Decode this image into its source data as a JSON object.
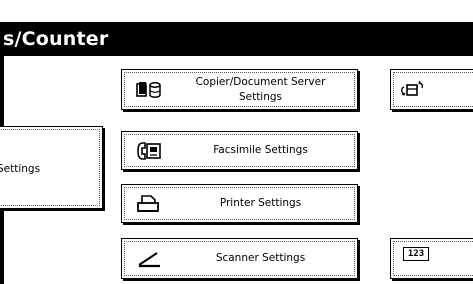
{
  "title": "s/Counter",
  "left_panel": {
    "settings_label": "Settings"
  },
  "buttons": {
    "copier": {
      "label_line1": "Copier/Document Server",
      "label_line2": "Settings",
      "icon": "copier-document-server-icon"
    },
    "facsimile": {
      "label": "Facsimile Settings",
      "icon": "facsimile-icon"
    },
    "printer": {
      "label": "Printer Settings",
      "icon": "printer-icon"
    },
    "scanner": {
      "label": "Scanner Settings",
      "icon": "scanner-icon"
    }
  },
  "right_buttons": {
    "top": {
      "icon": "transfer-icon"
    },
    "bottom": {
      "icon_text": "123",
      "icon": "counter-icon"
    }
  },
  "colors": {
    "title_bar_background": "#000000",
    "title_text": "#ffffff",
    "button_background": "#ffffff"
  }
}
